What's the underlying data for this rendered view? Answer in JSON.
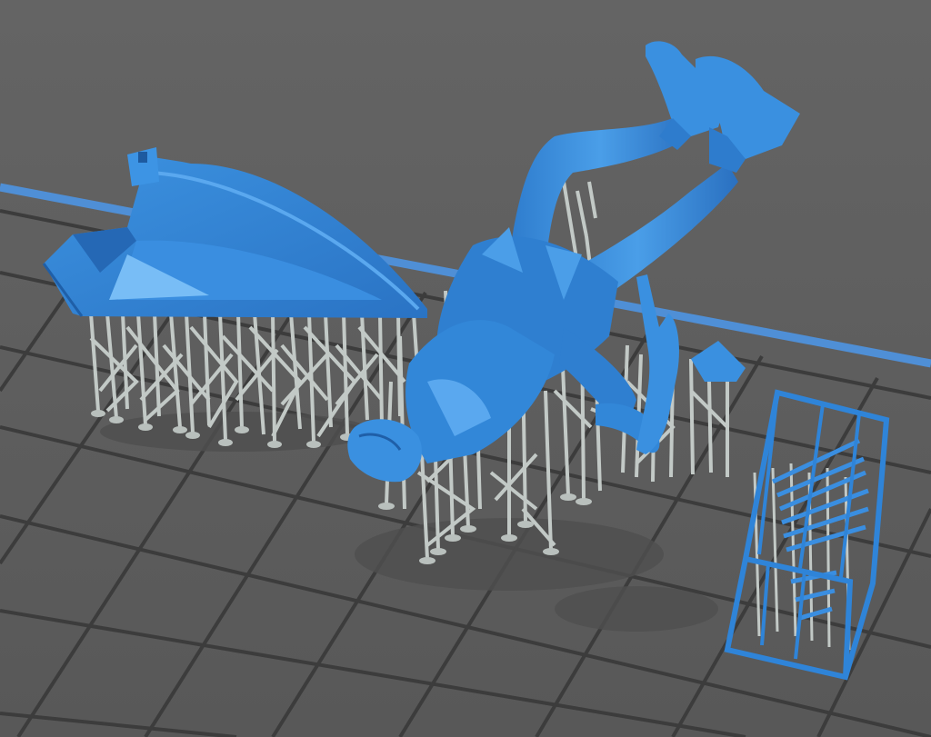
{
  "viewport": {
    "view": "perspective",
    "background_color": "#5f5f5f",
    "grid_line_color": "#3e3e3e",
    "build_plate_edge_color": "#4f8fd6",
    "model_color": "#2f7fd0",
    "model_highlight_color": "#5aa8ef",
    "support_color": "#c2c9c6",
    "support_shadow_color": "#8e9591"
  },
  "scene": {
    "objects": [
      {
        "name": "base-wedge",
        "has_supports": true
      },
      {
        "name": "figure",
        "has_supports": true
      },
      {
        "name": "arm-piece",
        "has_supports": true
      },
      {
        "name": "weapons-cage",
        "has_supports": true
      }
    ]
  }
}
